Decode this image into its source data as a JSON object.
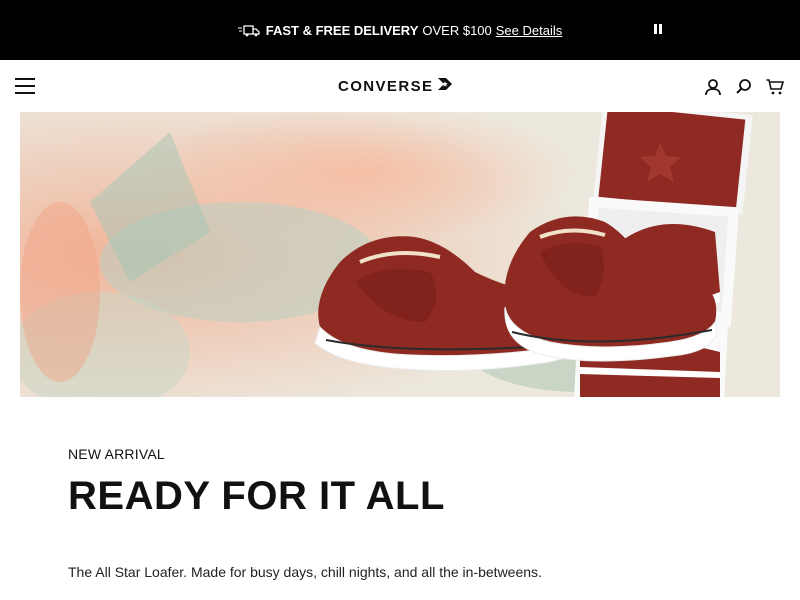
{
  "promo": {
    "bold_text": "FAST & FREE DELIVERY",
    "rest_text": "OVER $100",
    "link_text": "See Details",
    "icon": "delivery-truck-icon",
    "pause_icon": "pause-icon"
  },
  "header": {
    "logo_text": "CONVERSE",
    "logo_mark": "chevron-star-icon",
    "menu_icon": "hamburger-menu-icon",
    "icons": [
      "account-icon",
      "search-icon",
      "cart-icon"
    ]
  },
  "hero": {
    "image": "hero-image-all-star-loafer"
  },
  "content": {
    "eyebrow": "NEW ARRIVAL",
    "headline": "READY FOR IT ALL",
    "body": "The All Star Loafer. Made for busy days, chill nights, and all the in-betweens."
  },
  "colors": {
    "promo_bg": "#000000",
    "shoe": "#8f2a22",
    "text": "#111111"
  }
}
